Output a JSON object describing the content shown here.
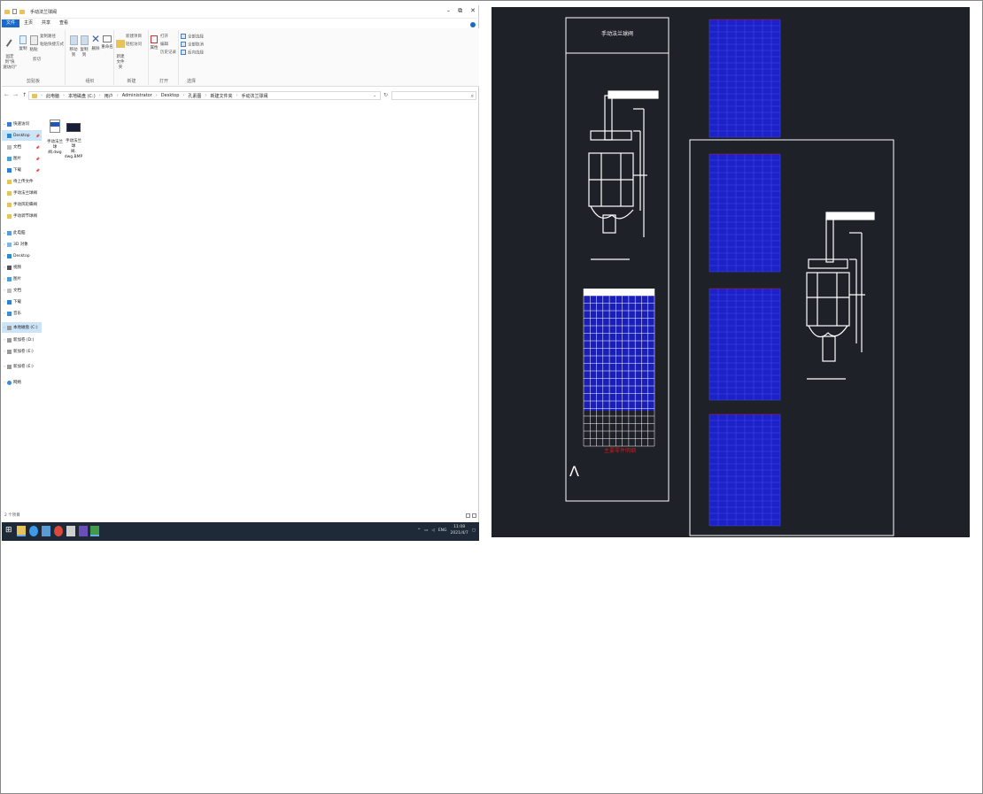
{
  "window": {
    "title": "手动法兰球阀",
    "controls": [
      "–",
      "⧉",
      "✕"
    ]
  },
  "ribbon": {
    "tabs": [
      "文件",
      "主页",
      "共享",
      "查看"
    ],
    "clipboard": {
      "label": "剪贴板",
      "pin": "固定到\"快\n速访问\"",
      "copy": "复制",
      "paste": "粘贴",
      "cut": "剪切",
      "copy_path": "复制路径",
      "paste_shortcut": "粘贴快捷方式"
    },
    "organize": {
      "label": "组织",
      "move_to": "移动到",
      "copy_to": "复制到",
      "delete": "删除",
      "rename": "重命名"
    },
    "new": {
      "label": "新建",
      "new_folder": "新建\n文件夹",
      "new_item": "新建项目",
      "easy_access": "轻松访问"
    },
    "open": {
      "label": "打开",
      "properties": "属性",
      "open": "打开",
      "edit": "编辑",
      "history": "历史记录"
    },
    "select": {
      "label": "选择",
      "select_all": "全部选择",
      "select_none": "全部取消",
      "invert": "反向选择"
    }
  },
  "address": {
    "crumbs": [
      "此电脑",
      "本地磁盘 (C:)",
      "用户",
      "Administrator",
      "Desktop",
      "孔素图",
      "新建文件夹",
      "手动法兰球阀"
    ]
  },
  "nav": {
    "quick_access": "快速访问",
    "quick_items": [
      "Desktop",
      "文档",
      "图片",
      "下载",
      "待上传文件",
      "手动法兰球阀",
      "手动风轮蝶阀",
      "手动调节球阀"
    ],
    "this_pc": "此电脑",
    "pc_items": [
      "3D 对象",
      "Desktop",
      "视频",
      "图片",
      "文档",
      "下载",
      "音乐",
      "本地磁盘 (C:)",
      "新加卷 (D:)",
      "新加卷 (E:)"
    ],
    "extra": "新加卷 (E:)",
    "network": "网络"
  },
  "files": [
    {
      "name": "手动法兰球\n阀.dwg",
      "type": "dwg"
    },
    {
      "name": "手动法兰球\n阀.\ndwg.BMP",
      "type": "bmp"
    }
  ],
  "status": {
    "count": "2 个项目"
  },
  "taskbar": {
    "lang": "ENG",
    "time": "11:08",
    "date": "2021/4/7"
  },
  "cad": {
    "title_block": "手动法兰球阀",
    "table_title": "主要零件明细",
    "bg": "#1e2128",
    "line": "#ffffff",
    "table_color": "#1d22c8",
    "accent": "#d01818"
  }
}
